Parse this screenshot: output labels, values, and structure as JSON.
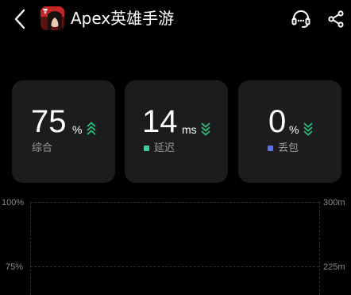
{
  "header": {
    "app_title": "Apex英雄手游",
    "icons": {
      "back": "back-arrow-icon",
      "app": "apex-legends-app-icon",
      "support": "headset-support-icon",
      "share": "share-icon"
    }
  },
  "stats": [
    {
      "value": "75",
      "unit": "%",
      "label": "综合",
      "trend": "up",
      "trend_color": "#2fbf7a"
    },
    {
      "value": "14",
      "unit": "ms",
      "label": "延迟",
      "trend": "down",
      "trend_color": "#2fbf7a",
      "legend_color": "#3ecf9e"
    },
    {
      "value": "0",
      "unit": "%",
      "label": "丢包",
      "trend": "down",
      "trend_color": "#2fbf7a",
      "legend_color": "#5b6ff2"
    }
  ],
  "chart": {
    "left_axis": [
      "100%",
      "75%"
    ],
    "right_axis": [
      "300m",
      "225m"
    ]
  },
  "colors": {
    "background": "#000000",
    "card": "#1c1c1e",
    "label_gray": "#9a9a9a",
    "accent_green": "#2fbf7a"
  }
}
